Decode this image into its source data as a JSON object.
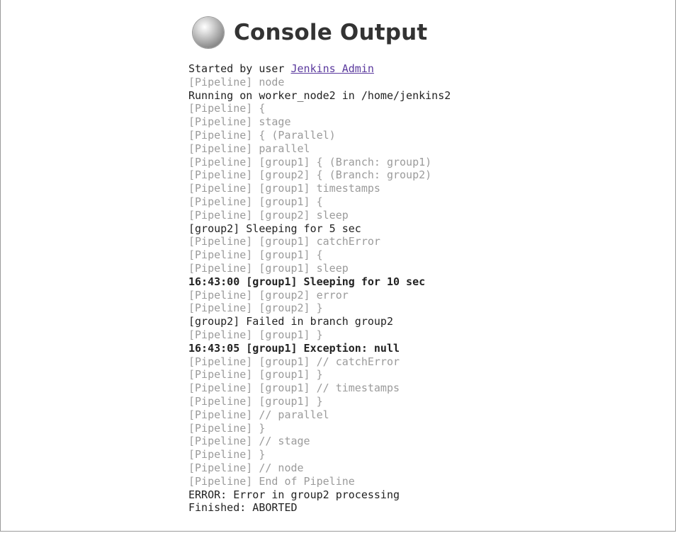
{
  "page": {
    "title": "Console Output"
  },
  "console": {
    "started_prefix": "Started by user ",
    "started_user": "Jenkins Admin",
    "lines": [
      {
        "style": "pipeline",
        "text": "[Pipeline] node"
      },
      {
        "style": "plain",
        "text": "Running on worker_node2 in /home/jenkins2"
      },
      {
        "style": "pipeline",
        "text": "[Pipeline] {"
      },
      {
        "style": "pipeline",
        "text": "[Pipeline] stage"
      },
      {
        "style": "pipeline",
        "text": "[Pipeline] { (Parallel)"
      },
      {
        "style": "pipeline",
        "text": "[Pipeline] parallel"
      },
      {
        "style": "pipeline",
        "text": "[Pipeline] [group1] { (Branch: group1)"
      },
      {
        "style": "pipeline",
        "text": "[Pipeline] [group2] { (Branch: group2)"
      },
      {
        "style": "pipeline",
        "text": "[Pipeline] [group1] timestamps"
      },
      {
        "style": "pipeline",
        "text": "[Pipeline] [group1] {"
      },
      {
        "style": "pipeline",
        "text": "[Pipeline] [group2] sleep"
      },
      {
        "style": "plain",
        "text": "[group2] Sleeping for 5 sec"
      },
      {
        "style": "pipeline",
        "text": "[Pipeline] [group1] catchError"
      },
      {
        "style": "pipeline",
        "text": "[Pipeline] [group1] {"
      },
      {
        "style": "pipeline",
        "text": "[Pipeline] [group1] sleep"
      },
      {
        "style": "timestamp",
        "ts": "16:43:00",
        "text": " [group1] Sleeping for 10 sec"
      },
      {
        "style": "pipeline",
        "text": "[Pipeline] [group2] error"
      },
      {
        "style": "pipeline",
        "text": "[Pipeline] [group2] }"
      },
      {
        "style": "plain",
        "text": "[group2] Failed in branch group2"
      },
      {
        "style": "pipeline",
        "text": "[Pipeline] [group1] }"
      },
      {
        "style": "timestamp",
        "ts": "16:43:05",
        "text": " [group1] Exception: null"
      },
      {
        "style": "pipeline",
        "text": "[Pipeline] [group1] // catchError"
      },
      {
        "style": "pipeline",
        "text": "[Pipeline] [group1] }"
      },
      {
        "style": "pipeline",
        "text": "[Pipeline] [group1] // timestamps"
      },
      {
        "style": "pipeline",
        "text": "[Pipeline] [group1] }"
      },
      {
        "style": "pipeline",
        "text": "[Pipeline] // parallel"
      },
      {
        "style": "pipeline",
        "text": "[Pipeline] }"
      },
      {
        "style": "pipeline",
        "text": "[Pipeline] // stage"
      },
      {
        "style": "pipeline",
        "text": "[Pipeline] }"
      },
      {
        "style": "pipeline",
        "text": "[Pipeline] // node"
      },
      {
        "style": "pipeline",
        "text": "[Pipeline] End of Pipeline"
      },
      {
        "style": "plain",
        "text": "ERROR: Error in group2 processing"
      },
      {
        "style": "plain",
        "text": "Finished: ABORTED"
      }
    ]
  },
  "colors": {
    "pipeline_text": "#9b9b9b",
    "plain_text": "#222222",
    "link": "#5b3a9e",
    "status": "aborted-grey"
  },
  "icons": {
    "status": "grey-status-ball-icon"
  }
}
